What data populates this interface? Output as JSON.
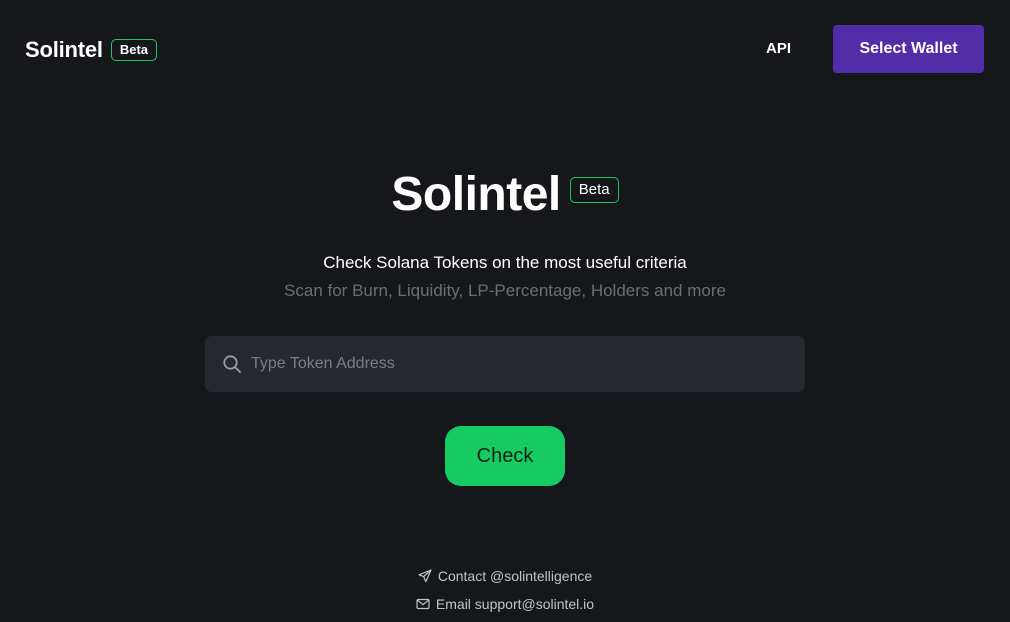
{
  "header": {
    "brand_name": "Solintel",
    "brand_badge": "Beta",
    "api_link": "API",
    "select_wallet_label": "Select Wallet"
  },
  "hero": {
    "title": "Solintel",
    "badge": "Beta",
    "tagline": "Check Solana Tokens on the most useful criteria",
    "subtagline": "Scan for Burn, Liquidity, LP-Percentage, Holders and more"
  },
  "search": {
    "icon": "search-icon",
    "placeholder": "Type Token Address",
    "value": ""
  },
  "check_button": {
    "label": "Check"
  },
  "footer": {
    "contact": {
      "icon": "send-icon",
      "text": "Contact @solintelligence"
    },
    "email": {
      "icon": "mail-icon",
      "text": "Email support@solintel.io"
    }
  },
  "colors": {
    "background": "#16171b",
    "accent_green": "#16cc62",
    "badge_border": "#22c55e",
    "wallet_button": "#512da8",
    "input_background": "#262830",
    "muted_text": "#6b6e76"
  }
}
